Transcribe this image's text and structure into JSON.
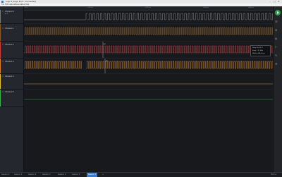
{
  "window": {
    "title": "Logic 2 [Logic Pro 8 - Connected]",
    "controls": [
      "–",
      "□",
      "✕"
    ]
  },
  "menu": [
    "File",
    "Edit",
    "Capture",
    "Measure",
    "View",
    "Help"
  ],
  "channels": [
    {
      "name": "Channel 0",
      "meta": "A: B:",
      "color": "#7a7a7a"
    },
    {
      "name": "Channel 1",
      "meta": "",
      "color": "#8b5a2b"
    },
    {
      "name": "Channel 2",
      "meta": "",
      "color": "#d23b3b"
    },
    {
      "name": "Channel 3",
      "meta": "",
      "color": "#e07b2a"
    },
    {
      "name": "Channel 4",
      "meta": "",
      "color": "#e6c229"
    },
    {
      "name": "Channel 5",
      "meta": "",
      "color": "#3bb34a"
    }
  ],
  "ruler": {
    "start": "0 s",
    "labels": [
      "+10 ms",
      "+20 ms",
      "+30 ms",
      "+40 ms"
    ]
  },
  "markers": {
    "a1": "A1",
    "a2": "A2"
  },
  "tooltip": {
    "lines": [
      "Duty: 55.05 %",
      "Freq: 1.11 kHz",
      "Width: 496.00 μs"
    ]
  },
  "tabs": [
    {
      "label": "Session 0",
      "active": false
    },
    {
      "label": "Session 1",
      "active": false
    },
    {
      "label": "Session 2",
      "active": false
    },
    {
      "label": "Session 3",
      "active": false
    },
    {
      "label": "Session 4",
      "active": false
    },
    {
      "label": "Session 5",
      "active": false
    },
    {
      "label": "Session 7",
      "active": true
    },
    {
      "label": "+",
      "active": false
    }
  ],
  "status_right": "500 ns",
  "icons": {
    "play": "play-icon",
    "right_tools": [
      "analyzers-icon",
      "measurements-icon",
      "extensions-icon",
      "timing-markers-icon",
      "notes-icon",
      "settings-icon"
    ]
  }
}
